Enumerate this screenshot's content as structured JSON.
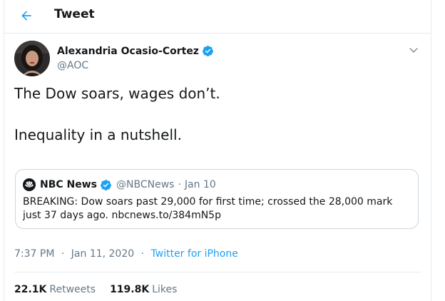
{
  "header": {
    "title": "Tweet",
    "back_icon": "arrow-left-icon"
  },
  "colors": {
    "accent": "#1da1f2",
    "text": "#14171a",
    "muted": "#657786",
    "border": "#e6ecf0"
  },
  "author": {
    "display_name": "Alexandria Ocasio-Cortez",
    "handle": "@AOC",
    "verified_icon": "verified-badge-icon"
  },
  "tweet": {
    "paragraphs": [
      "The Dow soars, wages don’t.",
      "Inequality in a nutshell."
    ]
  },
  "quoted_tweet": {
    "logo_icon": "nbc-peacock-icon",
    "display_name": "NBC News",
    "handle": "@NBCNews",
    "separator": "·",
    "date": "Jan 10",
    "text": "BREAKING: Dow soars past 29,000 for first time; crossed the 28,000 mark just 37 days ago. nbcnews.to/384mN5p"
  },
  "meta": {
    "time": "7:37 PM",
    "date": "Jan 11, 2020",
    "separator": "·",
    "source": "Twitter for iPhone"
  },
  "stats": {
    "retweets_count": "22.1K",
    "retweets_label": "Retweets",
    "likes_count": "119.8K",
    "likes_label": "Likes"
  }
}
